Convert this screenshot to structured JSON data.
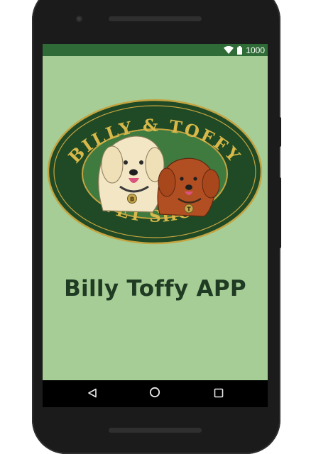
{
  "status_bar": {
    "time": "1000",
    "icons": [
      "wifi-icon",
      "battery-icon"
    ],
    "color": "#2f6b36"
  },
  "logo": {
    "top_text": "BILLY & TOFFY",
    "bottom_text": "PET SHOP",
    "tag_left": "B",
    "tag_right": "T"
  },
  "app": {
    "title": "Billy Toffy APP",
    "background": "#a6cd95"
  },
  "nav_bar": {
    "buttons": [
      "back-icon",
      "home-icon",
      "recents-icon"
    ]
  }
}
